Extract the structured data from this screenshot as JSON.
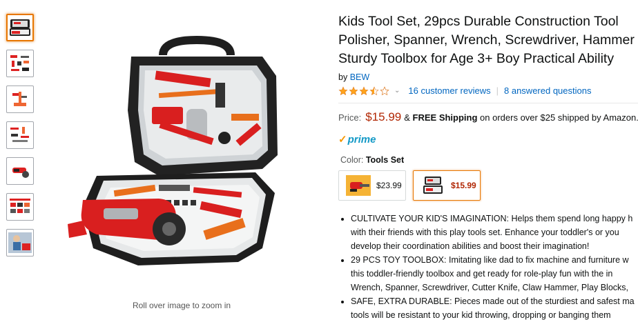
{
  "thumbnails": [
    {
      "name": "toolbox"
    },
    {
      "name": "tools-spread"
    },
    {
      "name": "tool-stand"
    },
    {
      "name": "tools-detail"
    },
    {
      "name": "grinder"
    },
    {
      "name": "size-chart"
    },
    {
      "name": "kid-playing"
    }
  ],
  "zoom_hint": "Roll over image to zoom in",
  "product": {
    "title_lines": [
      "Kids Tool Set, 29pcs Durable Construction Tool",
      "Polisher, Spanner, Wrench, Screwdriver, Hammer",
      "Sturdy Toolbox for Age 3+ Boy Practical Ability"
    ],
    "by_prefix": "by",
    "brand": "BEW",
    "rating_stars": 3.5,
    "reviews_link": "16 customer reviews",
    "questions_link": "8 answered questions",
    "price_label": "Price:",
    "price": "$15.99",
    "shipping_amp": "&",
    "free_shipping": "FREE Shipping",
    "shipping_rest": "on orders over $25 shipped by Amazon.",
    "prime_check": "✓",
    "prime_label": "prime",
    "color_label": "Color:",
    "color_value": "Tools Set",
    "swatches": [
      {
        "price": "$23.99",
        "selected": false
      },
      {
        "price": "$15.99",
        "selected": true
      }
    ],
    "bullets": [
      "CULTIVATE YOUR KID'S IMAGINATION: Helps them spend long happy h",
      "with their friends with this play tools set. Enhance your toddler's or you",
      "develop their coordination abilities and boost their imagination!",
      "29 PCS TOY TOOLBOX: Imitating like dad to fix machine and furniture w",
      "this toddler-friendly toolbox and get ready for role-play fun with the in",
      "Wrench, Spanner, Screwdriver, Cutter Knife, Claw Hammer, Play Blocks,",
      "SAFE, EXTRA DURABLE: Pieces made out of the sturdiest and safest ma",
      "tools will be resistant to your kid throwing, dropping or banging them"
    ]
  },
  "colors": {
    "link": "#0066c0",
    "price": "#b12704",
    "star": "#ffa41c",
    "prime": "#1399c6",
    "selected_border": "#e77600"
  }
}
